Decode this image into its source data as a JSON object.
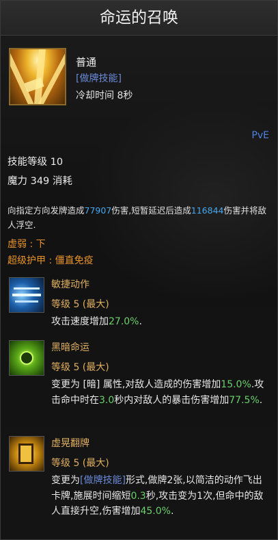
{
  "title": "命运的召唤",
  "skill": {
    "type": "普通",
    "tag": "[做牌技能]",
    "cooldown": "冷却时间 8秒",
    "mode": "PvE",
    "level_line": "技能等级 10",
    "mana_line": "魔力 349 消耗",
    "desc": {
      "p1": "向指定方向发牌造成",
      "dmg1": "77907",
      "p2": "伤害,短暂延迟后造成",
      "dmg2": "116844",
      "p3": "伤害并将敌人浮空."
    },
    "weak": "虚弱 : 下",
    "super_armor": "超级护甲 : 僵直免疫"
  },
  "runes": [
    {
      "icon": "blue-dash-icon",
      "name": "敏捷动作",
      "level": "等级 5 (最大)",
      "d1": "攻击速度增加",
      "v1": "27.0%",
      "d2": "."
    },
    {
      "icon": "dark-sun-icon",
      "name": "黑暗命运",
      "level": "等级 5 (最大)",
      "d1": "变更为 [暗] 属性,对敌人造成的伤害增加",
      "v1": "15.0%",
      "d2": ".攻击命中时在",
      "v2": "3.0",
      "d3": "秒内对敌人的暴击伤害增加",
      "v3": "77.5%",
      "d4": "."
    },
    {
      "icon": "golden-card-icon",
      "name": "虚晃翻牌",
      "level": "等级 5 (最大)",
      "d1": "变更为",
      "tag": "[做牌技能]",
      "d2": "形式,做牌2张,以简洁的动作飞出卡牌,施展时间缩短",
      "v1": "0.3",
      "d3": "秒,攻击变为1次,但命中的敌人直接升空,伤害增加",
      "v2": "45.0%",
      "d4": "."
    }
  ]
}
